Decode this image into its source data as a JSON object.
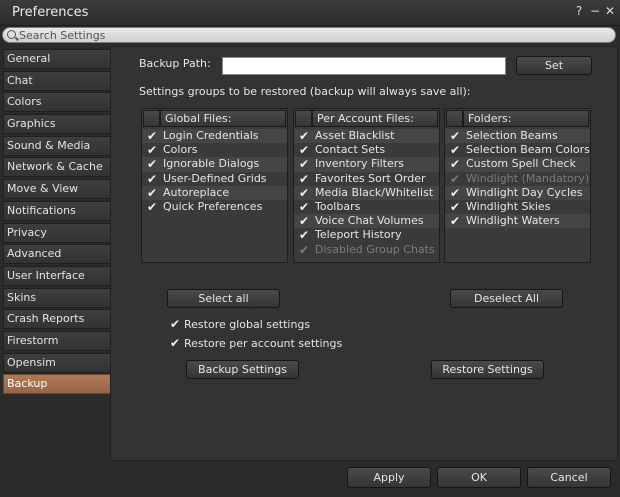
{
  "window": {
    "title": "Preferences",
    "help": "?",
    "minimize": "−",
    "close": "✕"
  },
  "search": {
    "placeholder": "Search Settings"
  },
  "sidebar": {
    "items": [
      {
        "label": "General"
      },
      {
        "label": "Chat"
      },
      {
        "label": "Colors"
      },
      {
        "label": "Graphics"
      },
      {
        "label": "Sound & Media"
      },
      {
        "label": "Network & Cache"
      },
      {
        "label": "Move & View"
      },
      {
        "label": "Notifications"
      },
      {
        "label": "Privacy"
      },
      {
        "label": "Advanced"
      },
      {
        "label": "User Interface"
      },
      {
        "label": "Skins"
      },
      {
        "label": "Crash Reports"
      },
      {
        "label": "Firestorm"
      },
      {
        "label": "Opensim"
      },
      {
        "label": "Backup"
      }
    ]
  },
  "backup": {
    "path_label": "Backup Path:",
    "path_value": "",
    "set_label": "Set",
    "groups_label": "Settings groups to be restored (backup will always save all):",
    "global": {
      "title": "Global Files:",
      "items": [
        "Login Credentials",
        "Colors",
        "Ignorable Dialogs",
        "User-Defined Grids",
        "Autoreplace",
        "Quick Preferences"
      ]
    },
    "account": {
      "title": "Per Account Files:",
      "items": [
        "Asset Blacklist",
        "Contact Sets",
        "Inventory Filters",
        "Favorites Sort Order",
        "Media Black/Whitelist",
        "Toolbars",
        "Voice Chat Volumes",
        "Teleport History",
        "Disabled Group Chats"
      ]
    },
    "folders": {
      "title": "Folders:",
      "items": [
        "Selection Beams",
        "Selection Beam Colors",
        "Custom Spell Check",
        "Windlight (Mandatory)",
        "Windlight Day Cycles",
        "Windlight Skies",
        "Windlight Waters"
      ]
    },
    "select_all": "Select all",
    "deselect_all": "Deselect All",
    "restore_global": "Restore global settings",
    "restore_account": "Restore per account settings",
    "backup_settings": "Backup Settings",
    "restore_settings": "Restore Settings"
  },
  "footer": {
    "apply": "Apply",
    "ok": "OK",
    "cancel": "Cancel"
  },
  "icons": {
    "checkmark": "✔",
    "search": "search-icon"
  },
  "colors": {
    "active_tab": "#a97050",
    "panel_bg": "#333333"
  }
}
